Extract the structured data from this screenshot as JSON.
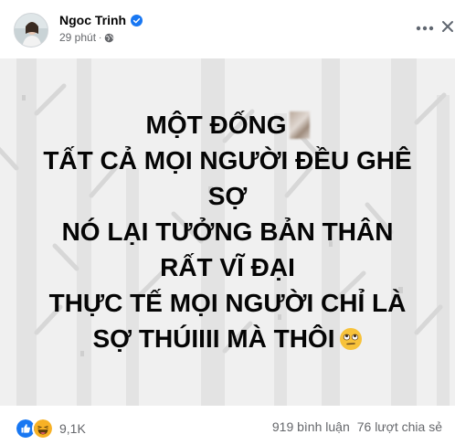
{
  "post": {
    "author": "Ngoc Trinh",
    "time": "29 phút",
    "separator": "·",
    "lines": [
      "MỘT ĐỐNG",
      "TẤT CẢ MỌI NGƯỜI ĐỀU GHÊ",
      "SỢ",
      "NÓ LẠI TƯỞNG BẢN THÂN",
      "RẤT VĨ ĐẠI",
      "THỰC TẾ MỌI NGƯỜI CHỈ LÀ",
      "SỢ THÚIIII MÀ THÔI"
    ],
    "background_color": "#f0f0f0"
  },
  "footer": {
    "reaction_count": "9,1K",
    "comments": "919 bình luận",
    "shares": "76 lượt chia sẻ"
  },
  "icons": {
    "verified": "verified-badge-icon",
    "privacy": "globe-icon",
    "more": "more-options-icon",
    "close": "close-icon",
    "reactions": [
      "like-reaction-icon",
      "haha-reaction-icon"
    ]
  },
  "colors": {
    "verified_blue": "#1877f2",
    "like_blue": "#1877f2",
    "haha_yellow": "#f7b125",
    "secondary_text": "#65676b"
  }
}
